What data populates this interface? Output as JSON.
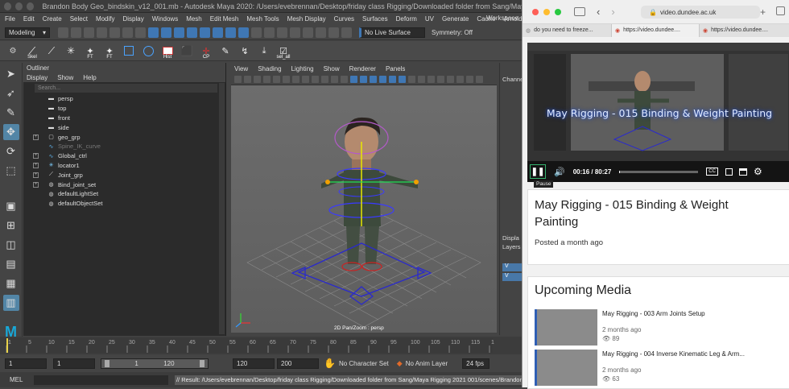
{
  "maya": {
    "title": "Brandon Body Geo_bindskin_v12_001.mb - Autodesk Maya 2020: /Users/evebrennan/Desktop/friday class Rigging/Downloaded folder from Sang/Maya Rigging 20",
    "menu": [
      "File",
      "Edit",
      "Create",
      "Select",
      "Modify",
      "Display",
      "Windows",
      "Mesh",
      "Edit Mesh",
      "Mesh Tools",
      "Mesh Display",
      "Curves",
      "Surfaces",
      "Deform",
      "UV",
      "Generate",
      "Cache",
      "Arnold",
      "Help"
    ],
    "workspace_label": "Workspace",
    "mode_dropdown": "Modeling",
    "live_surface": "No Live Surface",
    "symmetry": "Symmetry: Off",
    "shelf": [
      "Skel",
      "FT",
      "FT",
      "Hist",
      "CP",
      "sel_all"
    ],
    "outliner": {
      "title": "Outliner",
      "menu": [
        "Display",
        "Show",
        "Help"
      ],
      "search_placeholder": "Search...",
      "items": [
        {
          "label": "persp",
          "icon": "camera-icon",
          "expand": false,
          "dim": false
        },
        {
          "label": "top",
          "icon": "camera-icon",
          "expand": false,
          "dim": false
        },
        {
          "label": "front",
          "icon": "camera-icon",
          "expand": false,
          "dim": false
        },
        {
          "label": "side",
          "icon": "camera-icon",
          "expand": false,
          "dim": false
        },
        {
          "label": "geo_grp",
          "icon": "group-icon",
          "expand": true,
          "dim": false
        },
        {
          "label": "Spine_IK_curve",
          "icon": "curve-icon",
          "expand": false,
          "dim": true
        },
        {
          "label": "Global_ctrl",
          "icon": "curve-icon",
          "expand": true,
          "dim": false
        },
        {
          "label": "locator1",
          "icon": "locator-icon",
          "expand": true,
          "dim": false
        },
        {
          "label": "Joint_grp",
          "icon": "joint-icon",
          "expand": true,
          "dim": false
        },
        {
          "label": "Bind_joint_set",
          "icon": "set-icon",
          "expand": true,
          "dim": false
        },
        {
          "label": "defaultLightSet",
          "icon": "set-icon",
          "expand": false,
          "dim": false
        },
        {
          "label": "defaultObjectSet",
          "icon": "set-icon",
          "expand": false,
          "dim": false
        }
      ]
    },
    "viewport": {
      "menu": [
        "View",
        "Shading",
        "Lighting",
        "Show",
        "Renderer",
        "Panels"
      ],
      "label": "2D Pan/Zoom : persp"
    },
    "channel_label": "Channe",
    "display_label": "Displa",
    "layers_label": "Layers",
    "timeline_ticks": [
      "1",
      "5",
      "10",
      "15",
      "20",
      "25",
      "30",
      "35",
      "40",
      "45",
      "50",
      "55",
      "60",
      "65",
      "70",
      "75",
      "80",
      "85",
      "90",
      "95",
      "100",
      "105",
      "110",
      "115",
      "1"
    ],
    "range": {
      "start": "1",
      "current": "1",
      "slider_start": "1",
      "slider_end": "120",
      "end1": "120",
      "end2": "200",
      "character_set": "No Character Set",
      "anim_layer": "No Anim Layer",
      "fps": "24 fps"
    },
    "cmd_label": "MEL",
    "cmd_result": "// Result: /Users/evebrennan/Desktop/friday class Rigging/Downloaded folder from Sang/Maya Rigging 2021 001/scenes/Brandon Body Ge"
  },
  "safari": {
    "url": "video.dundee.ac.uk",
    "tabs": [
      "do you need to freeze...",
      "https://video.dundee....",
      "https://video.dundee...."
    ],
    "video": {
      "overlay_title": "May Rigging - 015 Binding & Weight Painting",
      "time": "00:16 / 80:27",
      "tooltip": "Pause",
      "cc": "CC",
      "progress": 0.0033
    },
    "page_title": "May Rigging - 015 Binding & Weight Painting",
    "posted": "Posted a month ago",
    "upcoming_title": "Upcoming Media",
    "upcoming": [
      {
        "title": "May Rigging - 003 Arm Joints Setup",
        "age": "2 months ago",
        "views": "89"
      },
      {
        "title": "May Rigging - 004 Inverse Kinematic Leg & Arm...",
        "age": "2 months ago",
        "views": "63"
      }
    ],
    "colors": {
      "accent": "#2f5fb4",
      "video_bg": "#1b1b1b"
    }
  }
}
